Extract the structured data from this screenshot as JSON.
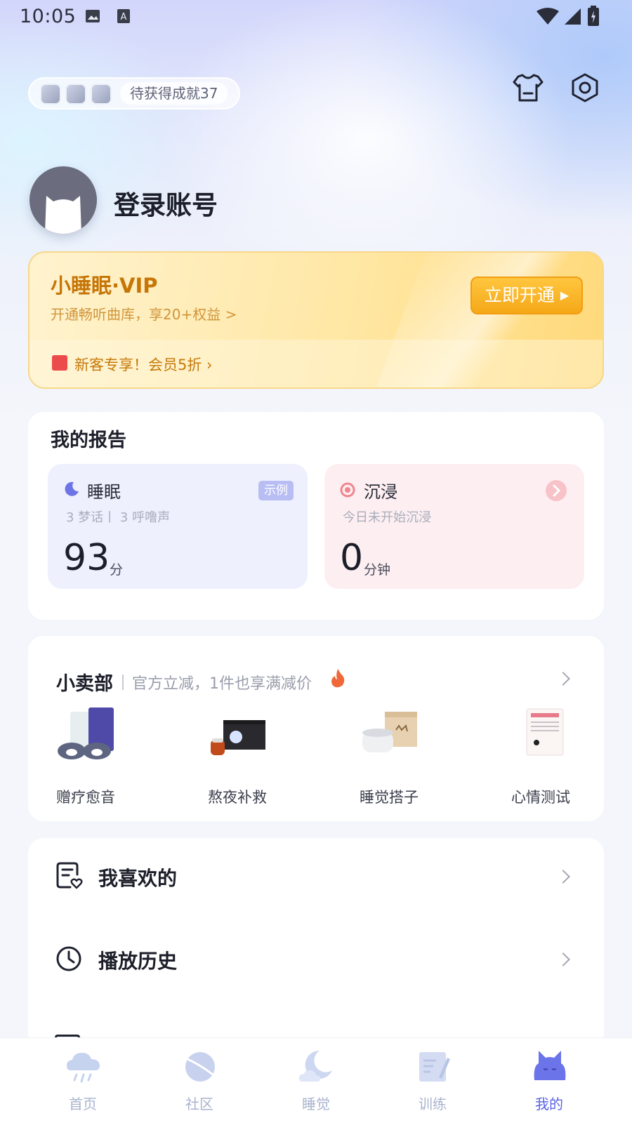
{
  "status_bar": {
    "time": "10:05"
  },
  "achievements": {
    "pending_label": "待获得成就37"
  },
  "profile": {
    "login_label": "登录账号"
  },
  "vip": {
    "title": "小睡眠·VIP",
    "subtitle": "开通畅听曲库，享20+权益 >",
    "cta": "立即开通",
    "promo": "新客专享！会员5折 ›"
  },
  "report": {
    "title": "我的报告",
    "sleep": {
      "title": "睡眠",
      "badge": "示例",
      "sub": "3 梦话丨 3 呼噜声",
      "score": "93",
      "unit": "分"
    },
    "immersion": {
      "title": "沉浸",
      "sub": "今日未开始沉浸",
      "value": "0",
      "unit": "分钟"
    }
  },
  "shop": {
    "title": "小卖部",
    "subtitle": "官方立减，1件也享满减价",
    "items": [
      {
        "label": "赠疗愈音"
      },
      {
        "label": "熬夜补救"
      },
      {
        "label": "睡觉搭子"
      },
      {
        "label": "心情测试"
      }
    ]
  },
  "lists": [
    {
      "label": "我喜欢的"
    },
    {
      "label": "播放历史"
    }
  ],
  "nav": [
    {
      "label": "首页",
      "active": false
    },
    {
      "label": "社区",
      "active": false
    },
    {
      "label": "睡觉",
      "active": false
    },
    {
      "label": "训练",
      "active": false
    },
    {
      "label": "我的",
      "active": true
    }
  ],
  "colors": {
    "accent": "#5a63e4",
    "vip_gold": "#c67507",
    "vip_button": "#f5a818",
    "sleep_tile": "#eef0fd",
    "immersion_tile": "#fdeff1"
  }
}
